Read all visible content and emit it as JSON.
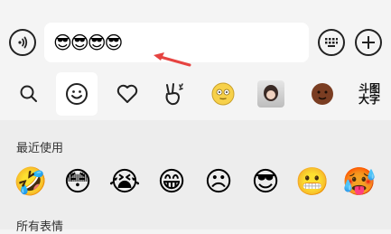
{
  "input": {
    "value": "😎😎😎😎"
  },
  "tabs": [
    {
      "name": "search",
      "label": "🔍"
    },
    {
      "name": "emoji",
      "label": "☺"
    },
    {
      "name": "favorites",
      "label": "♡"
    },
    {
      "name": "gestures",
      "label": "✌"
    },
    {
      "name": "smiley-sticker",
      "label": "🙂"
    },
    {
      "name": "photo-sticker",
      "label": ""
    },
    {
      "name": "brown-sticker",
      "label": ""
    },
    {
      "name": "doutu",
      "label": "斗图\n大字"
    }
  ],
  "recent": {
    "title": "最近使用",
    "items": [
      "🤣",
      "😳",
      "😭",
      "😁",
      "☹",
      "😎",
      "😬",
      "🥵"
    ]
  },
  "all": {
    "title": "所有表情"
  },
  "colors": {
    "accent": "#e64340",
    "bg": "#f4f4f4",
    "panel": "#ededed"
  }
}
